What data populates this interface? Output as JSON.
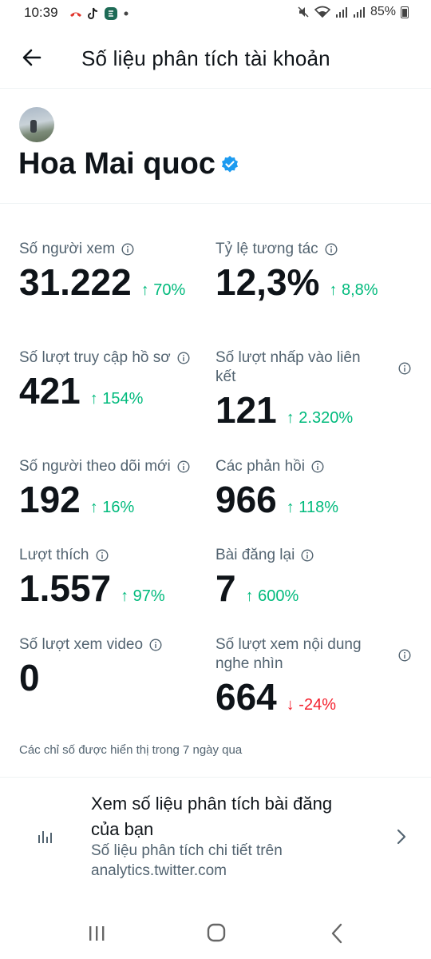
{
  "status_bar": {
    "time": "10:39",
    "battery": "85%"
  },
  "header": {
    "title": "Số liệu phân tích tài khoản"
  },
  "profile": {
    "name": "Hoa Mai quoc"
  },
  "metrics": [
    {
      "label": "Số người xem",
      "value": "31.222",
      "change": "↑ 70%",
      "trend": "up"
    },
    {
      "label": "Tỷ lệ tương tác",
      "value": "12,3%",
      "change": "↑ 8,8%",
      "trend": "up"
    },
    {
      "label": "Số lượt truy cập hồ sơ",
      "value": "421",
      "change": "↑ 154%",
      "trend": "up"
    },
    {
      "label_line1": "Số lượt nhấp vào liên",
      "label_line2": "kết",
      "value": "121",
      "change": "↑ 2.320%",
      "trend": "up"
    },
    {
      "label": "Số người theo dõi mới",
      "value": "192",
      "change": "↑ 16%",
      "trend": "up"
    },
    {
      "label": "Các phản hồi",
      "value": "966",
      "change": "↑ 118%",
      "trend": "up"
    },
    {
      "label": "Lượt thích",
      "value": "1.557",
      "change": "↑ 97%",
      "trend": "up"
    },
    {
      "label": "Bài đăng lại",
      "value": "7",
      "change": "↑ 600%",
      "trend": "up"
    },
    {
      "label": "Số lượt xem video",
      "value": "0",
      "change": "",
      "trend": "none"
    },
    {
      "label_line1": "Số lượt xem nội dung",
      "label_line2": "nghe nhìn",
      "value": "664",
      "change": "↓ -24%",
      "trend": "down"
    }
  ],
  "footnote": "Các chỉ số được hiển thị trong 7 ngày qua",
  "cta": {
    "title_line1": "Xem số liệu phân tích bài đăng",
    "title_line2": "của bạn",
    "subtitle_line1": "Số liệu phân tích chi tiết trên",
    "subtitle_line2": "analytics.twitter.com"
  },
  "colors": {
    "up": "#00ba7c",
    "down": "#f4212e",
    "verified": "#1d9bf0",
    "text": "#0f1419",
    "muted": "#536471"
  },
  "icons": [
    "back-arrow-icon",
    "verified-badge-icon",
    "info-icon",
    "bar-chart-icon",
    "chevron-right-icon",
    "recents-icon",
    "home-icon",
    "back-icon"
  ]
}
